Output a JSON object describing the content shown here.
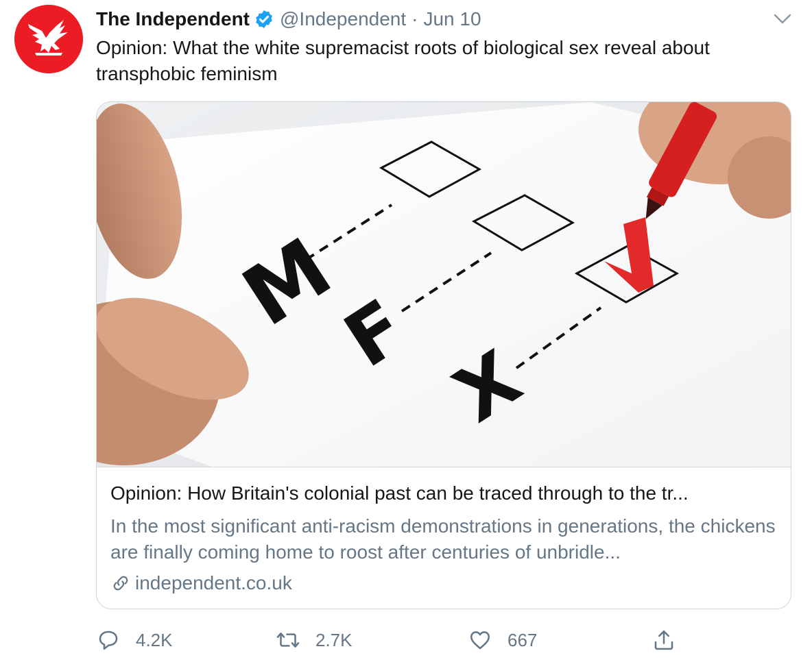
{
  "tweet": {
    "author_name": "The Independent",
    "handle": "@Independent",
    "separator": "·",
    "date": "Jun 10",
    "text": "Opinion: What the white supremacist roots of biological sex reveal about transphobic feminism"
  },
  "card": {
    "image_letters": [
      "M",
      "F",
      "X"
    ],
    "title": "Opinion: How Britain's colonial past can be traced through to the tr...",
    "description": "In the most significant anti-racism demonstrations in generations, the chickens are finally coming home to roost after centuries of unbridle...",
    "domain": "independent.co.uk"
  },
  "actions": {
    "replies": "4.2K",
    "retweets": "2.7K",
    "likes": "667"
  },
  "colors": {
    "brand_red": "#ec1c24",
    "verified_blue": "#1da1f2",
    "text_primary": "#14171a",
    "text_secondary": "#657786",
    "border": "#ccd6dd"
  },
  "icons": {
    "avatar": "independent-eagle-logo",
    "verified": "verified-badge-icon",
    "caret": "chevron-down-icon",
    "link": "link-icon",
    "reply": "reply-icon",
    "retweet": "retweet-icon",
    "like": "heart-icon",
    "share": "share-icon"
  }
}
